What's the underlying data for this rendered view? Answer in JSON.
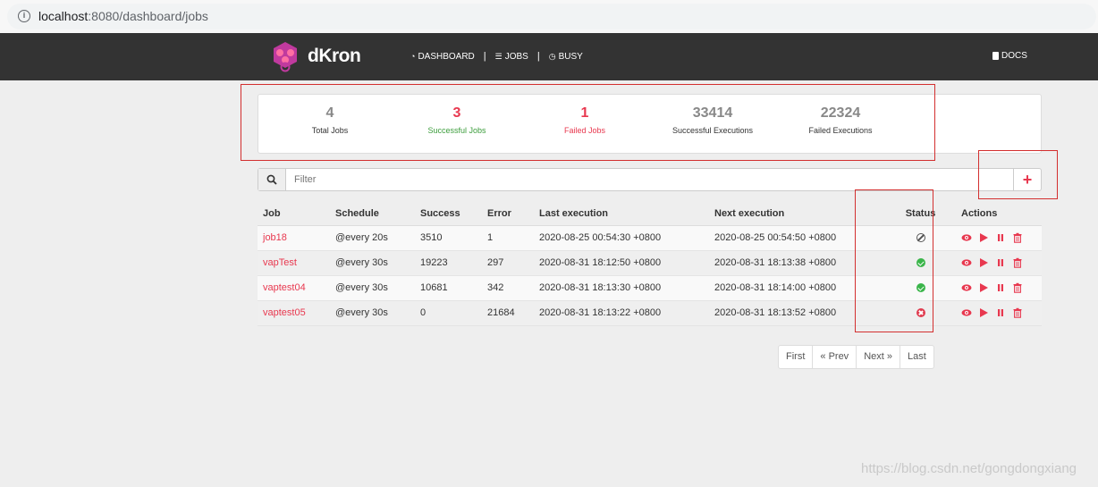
{
  "browser": {
    "url_host": "localhost",
    "url_rest": ":8080/dashboard/jobs"
  },
  "navbar": {
    "brand": "dKron",
    "items": [
      {
        "label": "DASHBOARD",
        "icon": "dashboard-icon"
      },
      {
        "label": "JOBS",
        "icon": "list-icon"
      },
      {
        "label": "BUSY",
        "icon": "clock-icon"
      }
    ],
    "docs_label": "DOCS"
  },
  "stats": [
    {
      "value": "4",
      "label": "Total Jobs"
    },
    {
      "value": "3",
      "label": "Successful Jobs"
    },
    {
      "value": "1",
      "label": "Failed Jobs"
    },
    {
      "value": "33414",
      "label": "Successful Executions"
    },
    {
      "value": "22324",
      "label": "Failed Executions"
    }
  ],
  "filter": {
    "placeholder": "Filter",
    "add_label": "+"
  },
  "table": {
    "headers": [
      "Job",
      "Schedule",
      "Success",
      "Error",
      "Last execution",
      "Next execution",
      "Status",
      "Actions"
    ],
    "rows": [
      {
        "job": "job18",
        "schedule": "@every 20s",
        "success": "3510",
        "error": "1",
        "last": "2020-08-25 00:54:30 +0800",
        "next": "2020-08-25 00:54:50 +0800",
        "status": "disabled"
      },
      {
        "job": "vapTest",
        "schedule": "@every 30s",
        "success": "19223",
        "error": "297",
        "last": "2020-08-31 18:12:50 +0800",
        "next": "2020-08-31 18:13:38 +0800",
        "status": "success"
      },
      {
        "job": "vaptest04",
        "schedule": "@every 30s",
        "success": "10681",
        "error": "342",
        "last": "2020-08-31 18:13:30 +0800",
        "next": "2020-08-31 18:14:00 +0800",
        "status": "success"
      },
      {
        "job": "vaptest05",
        "schedule": "@every 30s",
        "success": "0",
        "error": "21684",
        "last": "2020-08-31 18:13:22 +0800",
        "next": "2020-08-31 18:13:52 +0800",
        "status": "failed"
      }
    ]
  },
  "pagination": {
    "first": "First",
    "prev": "« Prev",
    "next": "Next »",
    "last": "Last"
  },
  "watermark": "https://blog.csdn.net/gongdongxiang",
  "colors": {
    "accent": "#e8384f",
    "success": "#3ab54a",
    "navbar": "#333333"
  }
}
